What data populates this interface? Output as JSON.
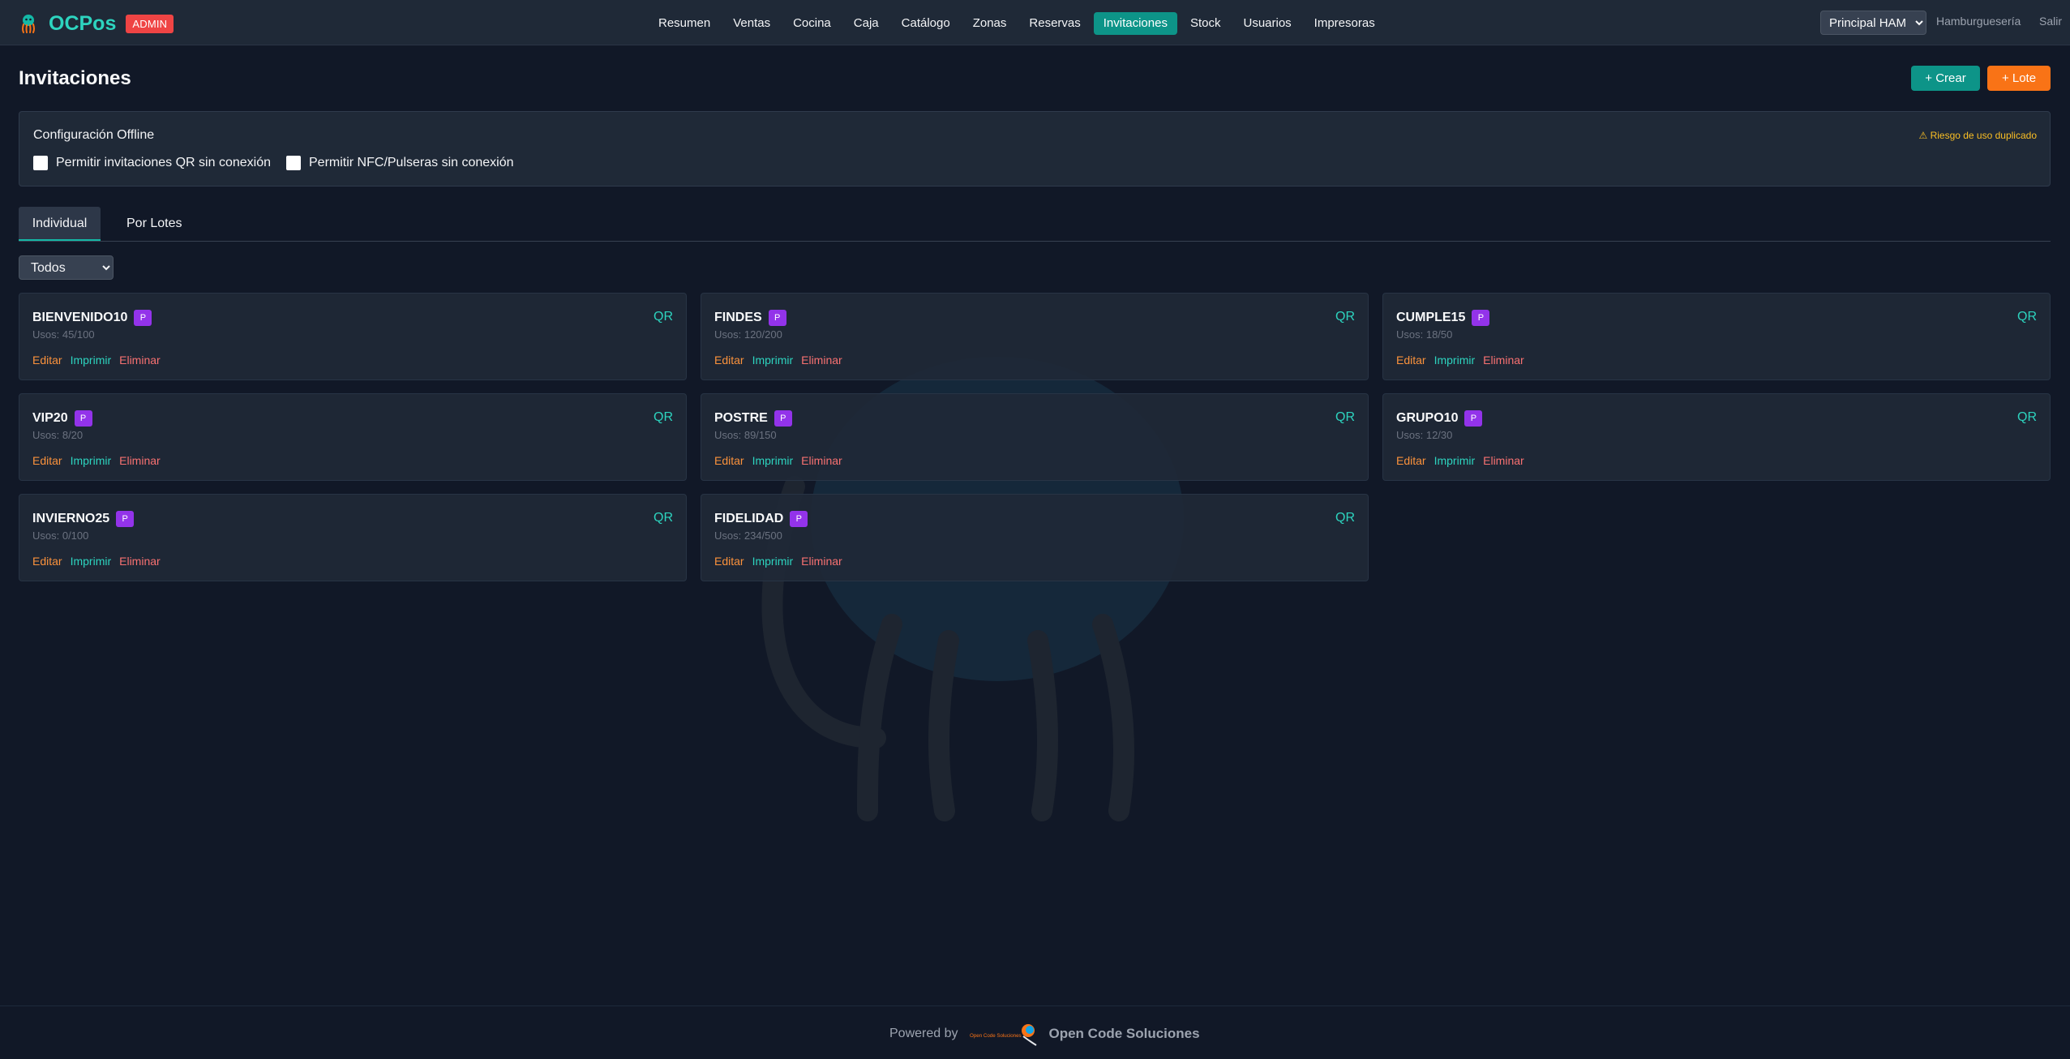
{
  "header": {
    "brand": "OCPos",
    "role_badge": "ADMIN",
    "nav": [
      "Resumen",
      "Ventas",
      "Cocina",
      "Caja",
      "Catálogo",
      "Zonas",
      "Reservas",
      "Invitaciones",
      "Stock",
      "Usuarios",
      "Impresoras"
    ],
    "active_nav": "Invitaciones",
    "branch": "Principal HAM",
    "store": "Hamburguesería",
    "logout": "Salir"
  },
  "page": {
    "title": "Invitaciones",
    "create_label": "+ Crear",
    "batch_label": "+ Lote"
  },
  "offline": {
    "title": "Configuración Offline",
    "risk_note": "Riesgo de uso duplicado",
    "allow_qr": "Permitir invitaciones QR sin conexión",
    "allow_nfc": "Permitir NFC/Pulseras sin conexión"
  },
  "tabs": {
    "individual": "Individual",
    "lotes": "Por Lotes"
  },
  "filter": {
    "selected": "Todos"
  },
  "card_labels": {
    "badge": "P",
    "edit": "Editar",
    "print": "Imprimir",
    "delete": "Eliminar"
  },
  "invitations": [
    {
      "code": "BIENVENIDO10",
      "type": "QR",
      "uses": "Usos: 45/100"
    },
    {
      "code": "FINDES",
      "type": "QR",
      "uses": "Usos: 120/200"
    },
    {
      "code": "CUMPLE15",
      "type": "QR",
      "uses": "Usos: 18/50"
    },
    {
      "code": "VIP20",
      "type": "QR",
      "uses": "Usos: 8/20"
    },
    {
      "code": "POSTRE",
      "type": "QR",
      "uses": "Usos: 89/150"
    },
    {
      "code": "GRUPO10",
      "type": "QR",
      "uses": "Usos: 12/30"
    },
    {
      "code": "INVIERNO25",
      "type": "QR",
      "uses": "Usos: 0/100"
    },
    {
      "code": "FIDELIDAD",
      "type": "QR",
      "uses": "Usos: 234/500"
    }
  ],
  "footer": {
    "powered_by": "Powered by",
    "company": "Open Code Soluciones",
    "logo_text": "Open Code Soluciones"
  },
  "colors": {
    "background": "#111827",
    "surface": "#1f2937",
    "accent": "#0d9488",
    "orange": "#f97316",
    "danger": "#ef4444",
    "badge_purple": "#9333ea"
  }
}
